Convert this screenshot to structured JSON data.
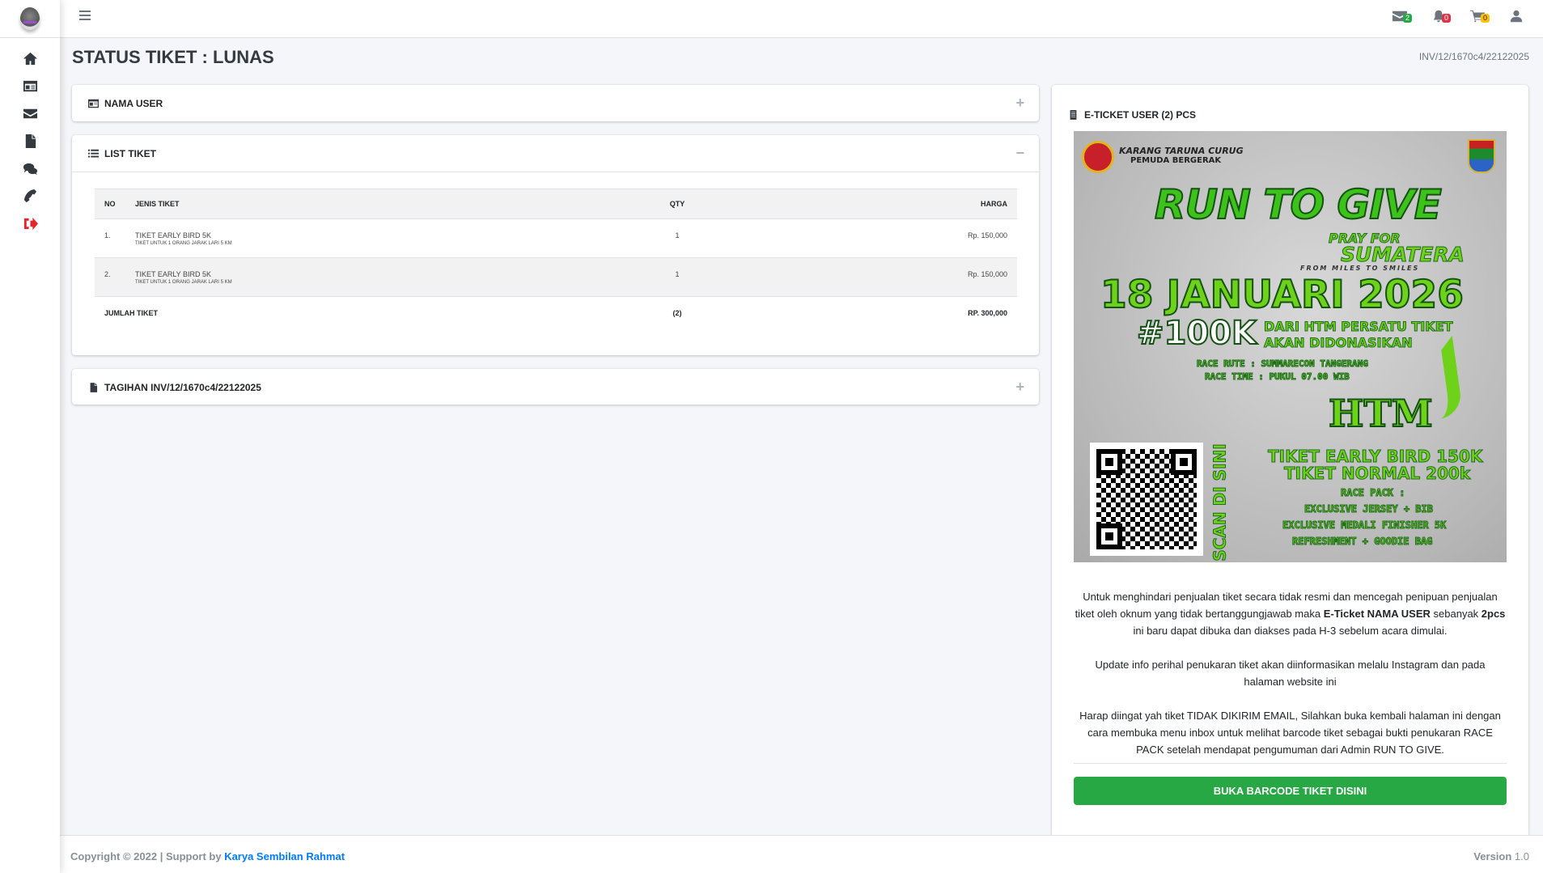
{
  "topbar": {
    "badges": {
      "messages": "2",
      "notifications": "0",
      "cart": "0"
    }
  },
  "page": {
    "title": "STATUS TIKET : LUNAS",
    "invoice": "INV/12/1670c4/22122025"
  },
  "cards": {
    "nama_user": "NAMA USER",
    "list_tiket": "LIST TIKET",
    "tagihan": "TAGIHAN INV/12/1670c4/22122025",
    "eticket": "E-TICKET USER (2) PCS",
    "expand": "+",
    "collapse": "−"
  },
  "table": {
    "headers": [
      "NO",
      "JENIS TIKET",
      "QTY",
      "HARGA"
    ],
    "rows": [
      {
        "no": "1.",
        "name": "TIKET EARLY BIRD 5K",
        "desc": "TIKET UNTUK 1 ORANG JARAK LARI 5 KM",
        "qty": "1",
        "price": "Rp. 150,000"
      },
      {
        "no": "2.",
        "name": "TIKET EARLY BIRD 5K",
        "desc": "TIKET UNTUK 1 ORANG JARAK LARI 5 KM",
        "qty": "1",
        "price": "Rp. 150,000"
      }
    ],
    "total": {
      "label": "JUMLAH TIKET",
      "qty": "(2)",
      "price": "RP. 300,000"
    }
  },
  "poster": {
    "org": "KARANG TARUNA CURUG",
    "org_sub": "PEMUDA BERGERAK",
    "title": "RUN TO GIVE",
    "pray": "PRAY FOR",
    "sumatera": "SUMATERA",
    "tagline": "FROM MILES TO SMILES",
    "date": "18 JANUARI 2026",
    "donation": "#100K",
    "donation_text1": "DARI HTM PERSATU TIKET",
    "donation_text2": "AKAN DIDONASIKAN",
    "route": "RACE RUTE : SUMMARECON TANGERANG",
    "time": "RACE TIME : PUKUL 07.00 WIB",
    "htm": "HTM",
    "early": "TIKET EARLY BIRD 150K",
    "normal": "TIKET NORMAL 200k",
    "scan": "SCAN DI SINI",
    "pack": "RACE PACK :",
    "pack1": "EXCLUSIVE JERSEY + BIB",
    "pack2": "EXCLUSIVE MEDALI FINISHER 5K",
    "pack3": "REFRESHMENT + GOODIE BAG"
  },
  "info": {
    "p1a": "Untuk menghindari penjualan tiket secara tidak resmi dan mencegah penipuan penjualan tiket oleh oknum yang tidak bertanggungjawab maka ",
    "p1b": "E-Ticket NAMA USER",
    "p1c": " sebanyak ",
    "p1d": "2pcs",
    "p1e": " ini baru dapat dibuka dan diakses pada H-3 sebelum acara dimulai.",
    "p2": "Update info perihal penukaran tiket akan diinformasikan melalu Instagram dan pada halaman website ini",
    "p3": "Harap diingat yah tiket TIDAK DIKIRIM EMAIL, Silahkan buka kembali halaman ini dengan cara membuka menu inbox untuk melihat barcode tiket sebagai bukti penukaran RACE PACK setelah mendapat pengumuman dari Admin RUN TO GIVE.",
    "button": "BUKA BARCODE TIKET DISINI"
  },
  "footer": {
    "copyright": "Copyright © 2022 | Support by ",
    "company": "Karya Sembilan Rahmat",
    "version_label": "Version",
    "version": "1.0"
  }
}
